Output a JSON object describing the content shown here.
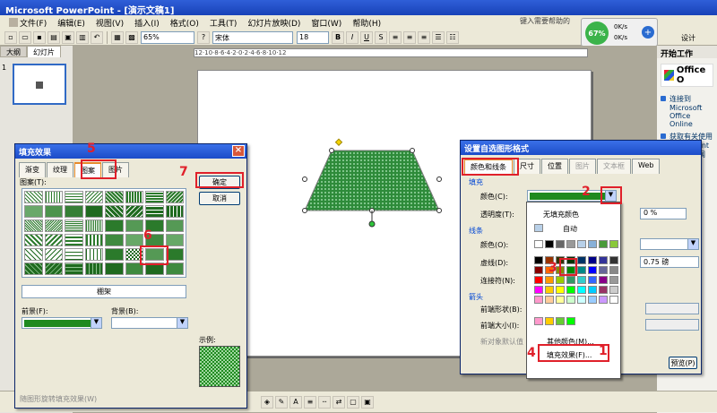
{
  "window": {
    "title": "Microsoft PowerPoint - [演示文稿1]"
  },
  "menu": {
    "items": [
      "文件(F)",
      "编辑(E)",
      "视图(V)",
      "插入(I)",
      "格式(O)",
      "工具(T)",
      "幻灯片放映(D)",
      "窗口(W)",
      "帮助(H)"
    ],
    "help_placeholder": "键入需要帮助的"
  },
  "toolbar": {
    "zoom": "65%",
    "font_name": "宋体",
    "font_size": "18",
    "design_label": "设计"
  },
  "network": {
    "percent": "67%",
    "up": "0K/s",
    "down": "0K/s"
  },
  "left_pane": {
    "tabs": [
      "大纲",
      "幻灯片"
    ],
    "slide_number": "1"
  },
  "ruler": {
    "text": "12·10·8·6·4·2·0·2·4·6·8·10·12"
  },
  "right_pane": {
    "title": "开始工作",
    "logo": "Office O",
    "items": [
      "连接到 Microsoft Office Online",
      "获取有关使用 PowerPoint 的最新新闻"
    ]
  },
  "fill_dialog": {
    "title": "填充效果",
    "tabs": [
      "渐变",
      "纹理",
      "图案",
      "图片"
    ],
    "pattern_label": "图案(T):",
    "pattern_name": "棚架",
    "foreground_label": "前景(F):",
    "background_label": "背景(B):",
    "sample_label": "示例:",
    "ok": "确定",
    "cancel": "取消",
    "rotate_label": "随图形旋转填充效果(W)"
  },
  "format_dialog": {
    "title": "设置自选图形格式",
    "tabs": [
      "颜色和线条",
      "尺寸",
      "位置",
      "图片",
      "文本框",
      "Web"
    ],
    "fill_section": "填充",
    "color_label": "颜色(C):",
    "transparency_label": "透明度(T):",
    "transparency_value": "0 %",
    "line_section": "线条",
    "line_color_label": "颜色(O):",
    "dash_label": "虚线(D):",
    "connector_label": "连接符(N):",
    "weight_value": "0.75 磅",
    "arrow_section": "箭头",
    "begin_style_label": "前端形状(B):",
    "begin_size_label": "前端大小(I):",
    "default_label": "新对象默认值",
    "preview_label": "预览(P)"
  },
  "color_popup": {
    "no_fill": "无填充颜色",
    "auto": "自动",
    "more_colors": "其他颜色(M)...",
    "fill_effects": "填充效果(F)..."
  },
  "annotations": [
    "1",
    "2",
    "3",
    "4",
    "5",
    "6",
    "7"
  ],
  "colors": {
    "shape_green": "#2e8b3a",
    "annotation_red": "#e0202a",
    "title_blue": "#1c4cc8"
  }
}
